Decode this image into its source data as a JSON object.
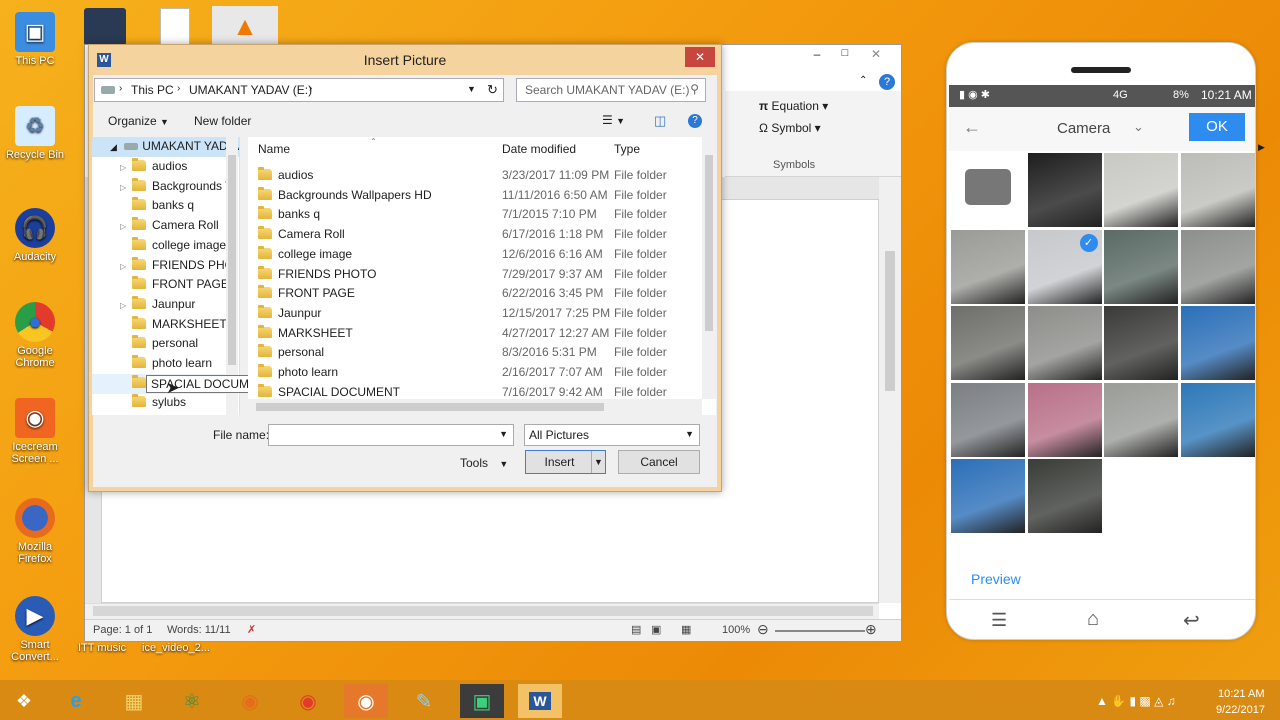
{
  "desktop": {
    "icons": [
      {
        "label": "This PC",
        "icon": "this-pc-icon",
        "color": "#3a8de0"
      },
      {
        "label": "Recycle Bin",
        "icon": "recycle-bin-icon",
        "color": "#cfe8ff"
      },
      {
        "label": "Audacity",
        "icon": "audacity-icon",
        "color": "#1c3f9e"
      },
      {
        "label": "Google Chrome",
        "icon": "chrome-icon",
        "color": "#e23b2c"
      },
      {
        "label": "Icecream Screen ...",
        "icon": "icecream-icon",
        "color": "#f06522"
      },
      {
        "label": "Mozilla Firefox",
        "icon": "firefox-icon",
        "color": "#e86a1c"
      },
      {
        "label": "Smart Convert...",
        "icon": "smart-converter-icon",
        "color": "#2a5bb5"
      }
    ],
    "bottom_labels": [
      "ITT music",
      "ice_video_2..."
    ]
  },
  "word": {
    "ribbon": {
      "equation": "Equation",
      "symbol": "Symbol",
      "group": "Symbols"
    },
    "status": {
      "page": "Page: 1 of 1",
      "words": "Words: 11/11",
      "zoom": "100%"
    }
  },
  "dialog": {
    "title": "Insert Picture",
    "breadcrumb": [
      "This PC",
      "UMAKANT YADAV (E:)"
    ],
    "search_placeholder": "Search UMAKANT YADAV (E:)",
    "toolbar": {
      "organize": "Organize",
      "new_folder": "New folder"
    },
    "tree_root": "UMAKANT YADAV",
    "tree": [
      "audios",
      "Backgrounds W",
      "banks q",
      "Camera Roll",
      "college image",
      "FRIENDS PHOT",
      "FRONT PAGE",
      "Jaunpur",
      "MARKSHEET",
      "personal",
      "photo learn",
      "SPACIAL DOCUMENT",
      "sylubs"
    ],
    "tooltip": "SPACIAL DOCUMENT",
    "columns": {
      "name": "Name",
      "date": "Date modified",
      "type": "Type"
    },
    "files": [
      {
        "name": "audios",
        "date": "3/23/2017 11:09 PM",
        "type": "File folder"
      },
      {
        "name": "Backgrounds Wallpapers HD",
        "date": "11/11/2016 6:50 AM",
        "type": "File folder"
      },
      {
        "name": "banks q",
        "date": "7/1/2015 7:10 PM",
        "type": "File folder"
      },
      {
        "name": "Camera Roll",
        "date": "6/17/2016 1:18 PM",
        "type": "File folder"
      },
      {
        "name": "college image",
        "date": "12/6/2016 6:16 AM",
        "type": "File folder"
      },
      {
        "name": "FRIENDS PHOTO",
        "date": "7/29/2017 9:37 AM",
        "type": "File folder"
      },
      {
        "name": "FRONT PAGE",
        "date": "6/22/2016 3:45 PM",
        "type": "File folder"
      },
      {
        "name": "Jaunpur",
        "date": "12/15/2017 7:25 PM",
        "type": "File folder"
      },
      {
        "name": "MARKSHEET",
        "date": "4/27/2017 12:27 AM",
        "type": "File folder"
      },
      {
        "name": "personal",
        "date": "8/3/2016 5:31 PM",
        "type": "File folder"
      },
      {
        "name": "photo learn",
        "date": "2/16/2017 7:07 AM",
        "type": "File folder"
      },
      {
        "name": "SPACIAL DOCUMENT",
        "date": "7/16/2017 9:42 AM",
        "type": "File folder"
      }
    ],
    "file_name_label": "File name:",
    "file_name_value": "",
    "filter": "All Pictures",
    "tools": "Tools",
    "insert": "Insert",
    "cancel": "Cancel"
  },
  "phone": {
    "status_battery": "8%",
    "status_time": "10:21 AM",
    "status_net": "4G",
    "header_title": "Camera",
    "ok": "OK",
    "preview": "Preview"
  },
  "taskbar": {
    "time": "10:21 AM",
    "date": "9/22/2017"
  }
}
